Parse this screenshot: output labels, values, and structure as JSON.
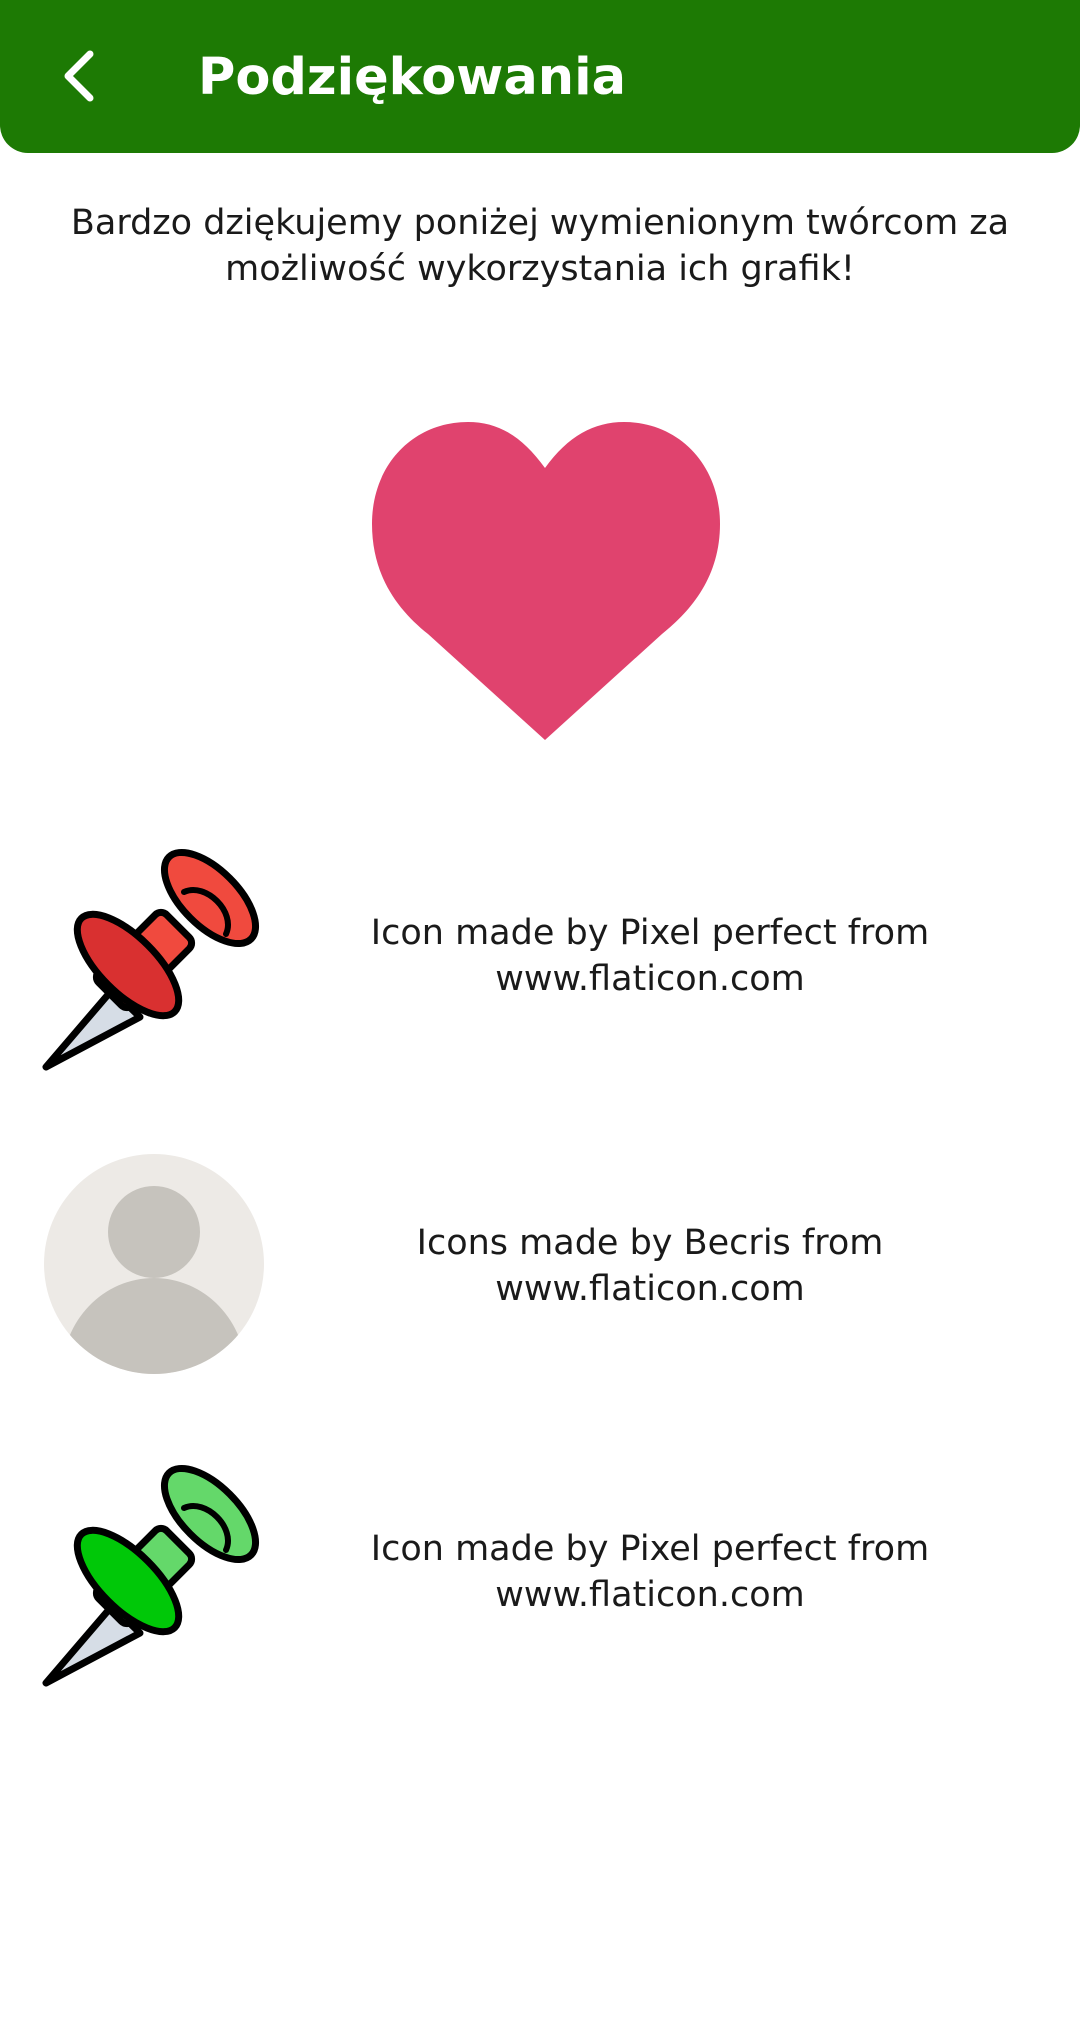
{
  "app_bar": {
    "title": "Podziękowania",
    "back_icon": "arrow-left-icon",
    "background_color": "#1d7a04"
  },
  "intro": {
    "text": "Bardzo dziękujemy poniżej wymienionym twórcom za możliwość wykorzystania ich grafik!"
  },
  "heart": {
    "icon": "heart-icon",
    "color": "#e0436e"
  },
  "credits": [
    {
      "icon": "red-pushpin-icon",
      "line1": "Icon made by Pixel perfect from",
      "line2": "www.flaticon.com"
    },
    {
      "icon": "user-avatar-icon",
      "line1": "Icons made by Becris from",
      "line2": "www.flaticon.com"
    },
    {
      "icon": "green-pushpin-icon",
      "line1": "Icon made by Pixel perfect from",
      "line2": "www.flaticon.com"
    }
  ]
}
